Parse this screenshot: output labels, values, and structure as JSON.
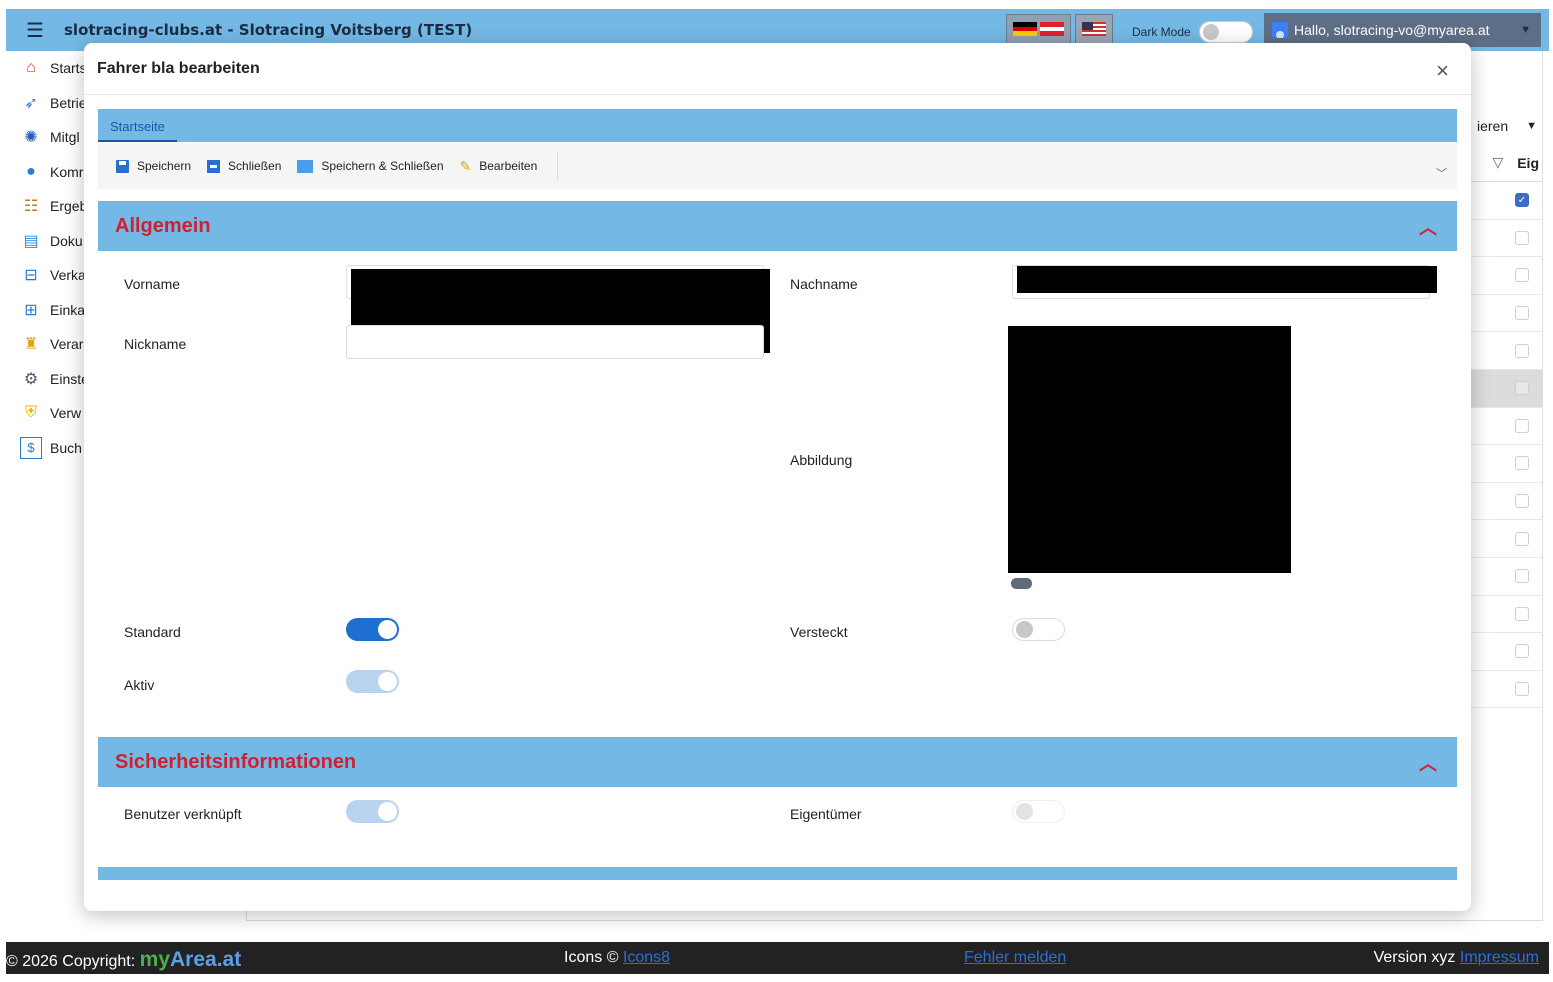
{
  "header": {
    "menu_icon": "☰",
    "title": "slotracing-clubs.at - Slotracing Voitsberg (TEST)",
    "dark_mode_label": "Dark Mode",
    "user_label": "Hallo, slotracing-vo@myarea.at"
  },
  "sidebar": {
    "items": [
      {
        "label": "Starts",
        "icon": "home-icon"
      },
      {
        "label": "Betrie",
        "icon": "rocket-icon"
      },
      {
        "label": "Mitgl",
        "icon": "members-icon"
      },
      {
        "label": "Komr",
        "icon": "chat-icon"
      },
      {
        "label": "Ergeb",
        "icon": "results-icon"
      },
      {
        "label": "Doku",
        "icon": "document-icon"
      },
      {
        "label": "Verka",
        "icon": "cart-out-icon"
      },
      {
        "label": "Einka",
        "icon": "cart-in-icon"
      },
      {
        "label": "Verar",
        "icon": "event-icon"
      },
      {
        "label": "Einste",
        "icon": "gear-icon"
      },
      {
        "label": "Verw",
        "icon": "shield-icon"
      },
      {
        "label": "Buch",
        "icon": "bookkeeping-icon"
      }
    ]
  },
  "background_grid": {
    "dropdown_text": "ieren",
    "column_header": "Eig"
  },
  "modal": {
    "title": "Fahrer bla bearbeiten",
    "close_icon": "×",
    "tab": "Startseite",
    "toolbar": {
      "save": "Speichern",
      "close": "Schließen",
      "save_close": "Speichern & Schließen",
      "edit": "Bearbeiten"
    },
    "section_general": {
      "title": "Allgemein",
      "vorname_label": "Vorname",
      "nachname_label": "Nachname",
      "nickname_label": "Nickname",
      "abbildung_label": "Abbildung",
      "standard_label": "Standard",
      "standard_value": true,
      "versteckt_label": "Versteckt",
      "versteckt_value": false,
      "aktiv_label": "Aktiv",
      "aktiv_value": true
    },
    "section_security": {
      "title": "Sicherheitsinformationen",
      "benutzer_label": "Benutzer verknüpft",
      "benutzer_value": true,
      "eigentuemer_label": "Eigentümer",
      "eigentuemer_value": false
    }
  },
  "footer": {
    "copyright": "© 2026 Copyright:",
    "brand_my": "my",
    "brand_area": "Area.at",
    "icons_prefix": "Icons ©",
    "icons_link": "Icons8",
    "report": "Fehler melden",
    "version": "Version xyz",
    "impressum": "Impressum"
  },
  "colors": {
    "header_bg": "#74b9e5",
    "section_title": "#d02030",
    "toggle_on": "#1f6fd0",
    "footer_bg": "#222222"
  }
}
